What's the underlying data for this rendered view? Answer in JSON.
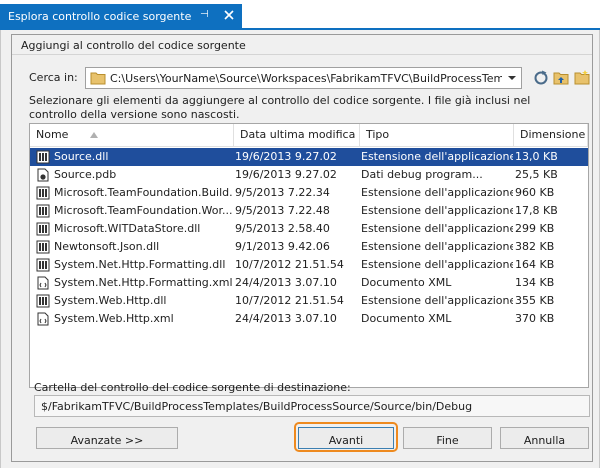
{
  "tab": {
    "title": "Esplora controllo codice sorgente",
    "pin": "⊣",
    "pin_icon": "pin-icon",
    "close_icon": "close-icon"
  },
  "dialog": {
    "title": "Aggiungi al controllo del codice sorgente",
    "lookin_label": "Cerca in:",
    "lookin_path": "C:\\Users\\YourName\\Source\\Workspaces\\FabrikamTFVC\\BuildProcessTem...",
    "toolbar_icons": [
      "refresh-icon",
      "folder-up-icon",
      "new-folder-icon"
    ],
    "hint": "Selezionare gli elementi da aggiungere al controllo del codice sorgente. I file già inclusi nel controllo della versione sono nascosti.",
    "columns": {
      "name": "Nome",
      "date": "Data ultima modifica",
      "type": "Tipo",
      "size": "Dimensione"
    },
    "files": [
      {
        "name": "Source.dll",
        "date": "19/6/2013 9.27.02",
        "type": "Estensione dell'applicazione",
        "size": "13,0 KB",
        "icon": "dll-icon",
        "selected": true
      },
      {
        "name": "Source.pdb",
        "date": "19/6/2013 9.27.02",
        "type": "Dati debug program...",
        "size": "25,5 KB",
        "icon": "pdb-icon",
        "selected": false
      },
      {
        "name": "Microsoft.TeamFoundation.Build...",
        "date": "9/5/2013 7.22.34",
        "type": "Estensione dell'applicazione",
        "size": "960 KB",
        "icon": "dll-icon",
        "selected": false
      },
      {
        "name": "Microsoft.TeamFoundation.Wor...",
        "date": "9/5/2013 7.22.48",
        "type": "Estensione dell'applicazione",
        "size": "17,8 KB",
        "icon": "dll-icon",
        "selected": false
      },
      {
        "name": "Microsoft.WITDataStore.dll",
        "date": "9/5/2013 2.58.40",
        "type": "Estensione dell'applicazione",
        "size": "299 KB",
        "icon": "dll-icon",
        "selected": false
      },
      {
        "name": "Newtonsoft.Json.dll",
        "date": "9/1/2013 9.42.06",
        "type": "Estensione dell'applicazione",
        "size": "382 KB",
        "icon": "dll-icon",
        "selected": false
      },
      {
        "name": "System.Net.Http.Formatting.dll",
        "date": "10/7/2012 21.51.54",
        "type": "Estensione dell'applicazione",
        "size": "164 KB",
        "icon": "dll-icon",
        "selected": false
      },
      {
        "name": "System.Net.Http.Formatting.xml",
        "date": "24/4/2013 3.07.10",
        "type": "Documento XML",
        "size": "134 KB",
        "icon": "xml-icon",
        "selected": false
      },
      {
        "name": "System.Web.Http.dll",
        "date": "10/7/2012 21.51.54",
        "type": "Estensione dell'applicazione",
        "size": "355 KB",
        "icon": "dll-icon",
        "selected": false
      },
      {
        "name": "System.Web.Http.xml",
        "date": "24/4/2013 3.07.10",
        "type": "Documento XML",
        "size": "370 KB",
        "icon": "xml-icon",
        "selected": false
      }
    ],
    "dest_label": "Cartella del controllo del codice sorgente di destinazione:",
    "dest_path": "$/FabrikamTFVC/BuildProcessTemplates/BuildProcessSource/Source/bin/Debug",
    "buttons": {
      "advanced": "Avanzate >>",
      "next": "Avanti",
      "finish": "Fine",
      "cancel": "Annulla"
    }
  },
  "colors": {
    "accent": "#0e70c0",
    "selection": "#1f4e9c",
    "highlight": "#ee8a1f"
  }
}
